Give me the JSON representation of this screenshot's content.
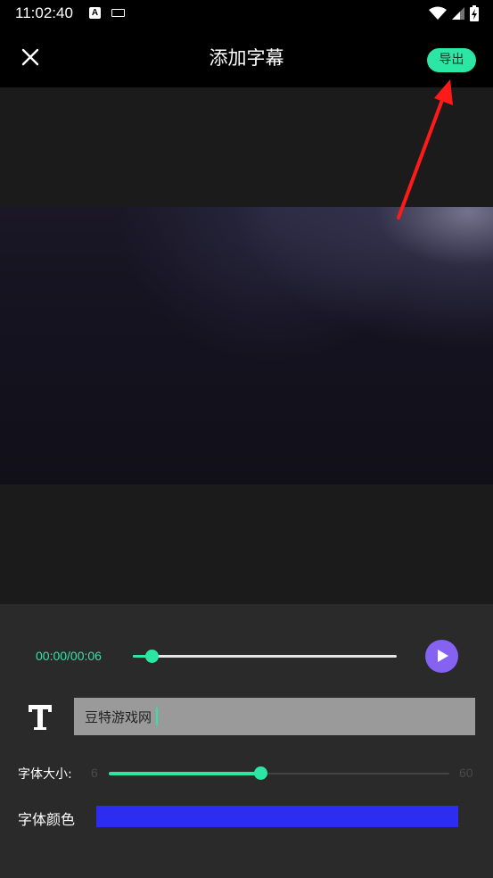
{
  "status_bar": {
    "time": "11:02:40",
    "notification_icons": [
      "a-icon",
      "keyboard-icon"
    ],
    "system_icons": [
      "wifi-icon",
      "signal-icon",
      "battery-icon"
    ]
  },
  "header": {
    "title": "添加字幕",
    "export_label": "导出",
    "close_icon": "close-icon"
  },
  "player": {
    "time_readout": "00:00/00:06",
    "progress": 0.07,
    "play_icon": "play-icon"
  },
  "subtitle": {
    "text_icon": "text-icon",
    "value": "豆特游戏网"
  },
  "font_size": {
    "label": "字体大小:",
    "min_label": "6",
    "max_label": "60",
    "min": 6,
    "max": 60,
    "value": 30
  },
  "font_color": {
    "label": "字体颜色",
    "value": "#2d2df2"
  },
  "colors": {
    "accent": "#2ce6a6",
    "play": "#8562f2",
    "annotation": "#ff1a1a"
  }
}
